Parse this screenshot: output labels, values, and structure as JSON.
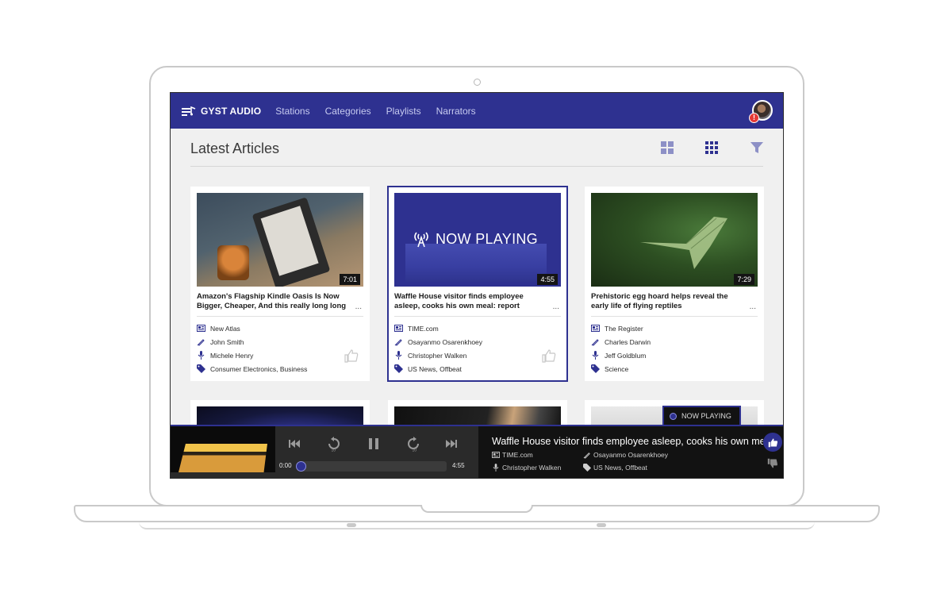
{
  "app": {
    "brand": "GYST AUDIO",
    "nav": [
      "Stations",
      "Categories",
      "Playlists",
      "Narrators"
    ],
    "alert_badge": "!"
  },
  "page": {
    "title": "Latest Articles"
  },
  "cards": [
    {
      "title": "Amazon's Flagship Kindle Oasis Is Now Bigger, Cheaper, And this really long long",
      "duration": "7:01",
      "source": "New Atlas",
      "author": "John Smith",
      "narrator": "Michele Henry",
      "tags": "Consumer Electronics, Business",
      "more": "..."
    },
    {
      "title": "Waffle House visitor finds employee asleep, cooks his own meal: report",
      "duration": "4:55",
      "overlay": "NOW PLAYING",
      "source": "TIME.com",
      "author": "Osayanmo Osarenkhoey",
      "narrator": "Christopher Walken",
      "tags": "US News, Offbeat",
      "more": "..."
    },
    {
      "title": "Prehistoric egg hoard helps reveal the early life of flying reptiles",
      "duration": "7:29",
      "source": "The Register",
      "author": "Charles Darwin",
      "narrator": "Jeff Goldblum",
      "tags": "Science",
      "more": "..."
    }
  ],
  "now_playing_badge": "NOW PLAYING",
  "player": {
    "title": "Waffle House visitor finds employee asleep, cooks his own me...",
    "source": "TIME.com",
    "author": "Osayanmo Osarenkhoey",
    "narrator": "Christopher Walken",
    "tags": "US News, Offbeat",
    "elapsed": "0:00",
    "total": "4:55",
    "skip_seconds": "10",
    "progress": 0.0
  },
  "colors": {
    "primary": "#2e3190",
    "nav_link": "#c7cbf0",
    "background": "#f0f0f0",
    "player_bg": "#121212"
  }
}
